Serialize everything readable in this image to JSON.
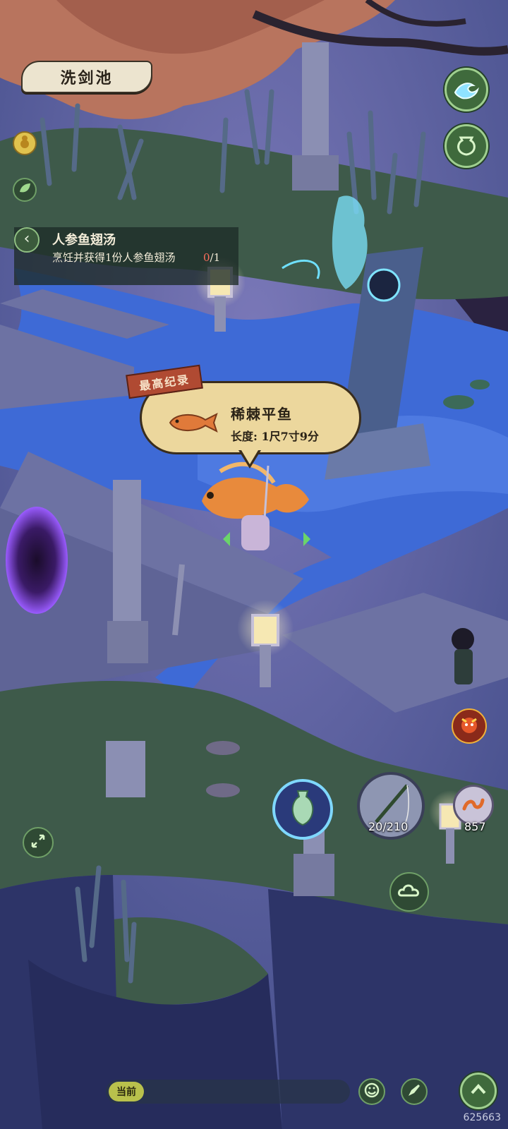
{
  "location": {
    "name": "洗剑池"
  },
  "quest": {
    "title": "人参鱼翅汤",
    "description": "烹饪并获得1份人参鱼翅汤",
    "progress_current": "0",
    "progress_total": "/1",
    "back_symbol": "‹"
  },
  "catch": {
    "record_label": "最高纪录",
    "fish_name": "稀棘平鱼",
    "length_label": "长度: 1尺7寸9分"
  },
  "tools": {
    "rod_durability": "20/210",
    "bait_count": "857"
  },
  "chat": {
    "channel_label": "当前"
  },
  "watermark": "625663",
  "icons": {
    "wave": "wave-icon",
    "jar": "jar-icon",
    "gourd": "gold-gourd-icon",
    "leaf": "leaf-icon",
    "vase": "vase-icon",
    "rod": "fishing-rod-icon",
    "worm": "bait-worm-icon",
    "cloud": "cloud-icon",
    "expand": "expand-icon",
    "emoji": "emoji-icon",
    "pen": "pen-icon",
    "up": "chevron-up-icon",
    "demon": "demon-face-icon"
  },
  "colors": {
    "accent_green": "#3f6a3c",
    "bubble": "#ecd79d",
    "record_red": "#b04a32",
    "progress_red": "#ff6e5c"
  }
}
